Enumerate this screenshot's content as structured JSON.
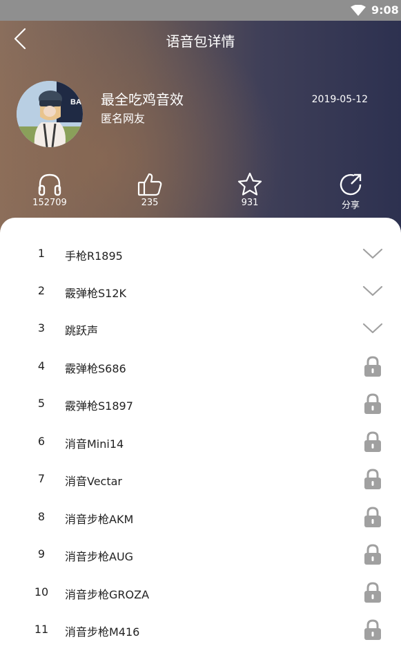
{
  "status_bar": {
    "time": "9:08",
    "wifi_icon": "wifi-icon"
  },
  "header": {
    "back_icon": "back-chevron-icon",
    "title": "语音包详情"
  },
  "pack": {
    "name": "最全吃鸡音效",
    "author": "匿名网友",
    "date": "2019-05-12",
    "avatar_icon": "avatar-image",
    "avatar_badge_text": "BAT"
  },
  "stats": [
    {
      "icon": "headphones-icon",
      "value": "152709"
    },
    {
      "icon": "thumbs-up-icon",
      "value": "235"
    },
    {
      "icon": "star-icon",
      "value": "931"
    },
    {
      "icon": "share-icon",
      "value": "分享"
    }
  ],
  "tracks": [
    {
      "num": "1",
      "title": "手枪R1895",
      "state": "expand",
      "icon": "chevron-down-icon"
    },
    {
      "num": "2",
      "title": "霰弹枪S12K",
      "state": "expand",
      "icon": "chevron-down-icon"
    },
    {
      "num": "3",
      "title": "跳跃声",
      "state": "expand",
      "icon": "chevron-down-icon"
    },
    {
      "num": "4",
      "title": "霰弹枪S686",
      "state": "locked",
      "icon": "lock-icon"
    },
    {
      "num": "5",
      "title": "霰弹枪S1897",
      "state": "locked",
      "icon": "lock-icon"
    },
    {
      "num": "6",
      "title": "消音Mini14",
      "state": "locked",
      "icon": "lock-icon"
    },
    {
      "num": "7",
      "title": "消音Vectar",
      "state": "locked",
      "icon": "lock-icon"
    },
    {
      "num": "8",
      "title": "消音步枪AKM",
      "state": "locked",
      "icon": "lock-icon"
    },
    {
      "num": "9",
      "title": "消音步枪AUG",
      "state": "locked",
      "icon": "lock-icon"
    },
    {
      "num": "10",
      "title": "消音步枪GROZA",
      "state": "locked",
      "icon": "lock-icon"
    },
    {
      "num": "11",
      "title": "消音步枪M416",
      "state": "locked",
      "icon": "lock-icon"
    }
  ],
  "colors": {
    "icon_gray": "#a0a0a0",
    "text": "#222222"
  }
}
